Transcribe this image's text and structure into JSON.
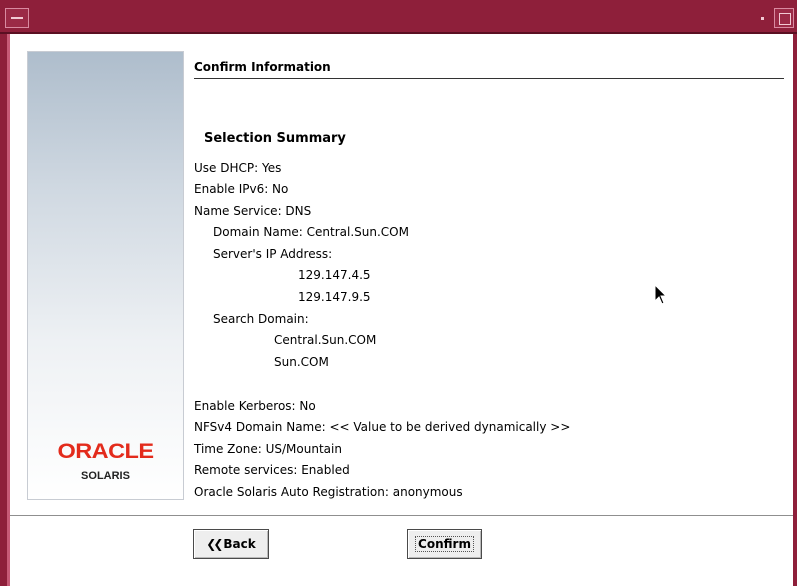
{
  "header": {
    "title": "Confirm Information"
  },
  "sidebar": {
    "logo_brand": "ORACLE",
    "logo_product": "SOLARIS",
    "brand_color": "#e32b1c"
  },
  "summary": {
    "title": "Selection Summary",
    "use_dhcp": "Use DHCP: Yes",
    "enable_ipv6": "Enable IPv6: No",
    "name_service": "Name Service: DNS",
    "domain_name": "Domain Name: Central.Sun.COM",
    "server_ip_label": "Server's IP Address:",
    "server_ips": [
      "129.147.4.5",
      "129.147.9.5"
    ],
    "search_domain_label": "Search Domain:",
    "search_domains": [
      "Central.Sun.COM",
      "Sun.COM"
    ],
    "enable_kerberos": "Enable Kerberos: No",
    "nfsv4_domain": "NFSv4 Domain Name: << Value to be derived dynamically >>",
    "time_zone": "Time Zone: US/Mountain",
    "remote_services": "Remote services: Enabled",
    "auto_registration": "Oracle Solaris Auto Registration: anonymous"
  },
  "buttons": {
    "back": "Back",
    "back_icon": "double-chevron-left-icon",
    "confirm": "Confirm"
  },
  "colors": {
    "titlebar": "#8e1f3a",
    "window_bg": "#ffffff"
  }
}
